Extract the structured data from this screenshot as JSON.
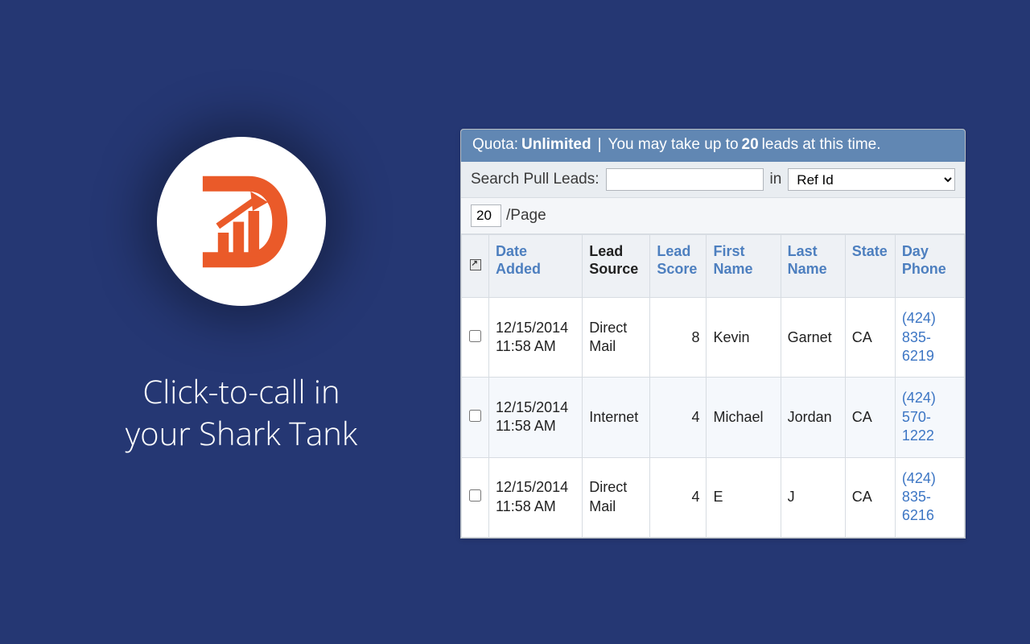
{
  "brand": {
    "accent": "#ea5a29"
  },
  "left": {
    "tagline_l1": "Click-to-call in",
    "tagline_l2": "your Shark Tank"
  },
  "quota": {
    "label": "Quota:",
    "value": "Unlimited",
    "msg_pre": "You may take up to",
    "max": "20",
    "msg_post": "leads at this time."
  },
  "search": {
    "label": "Search Pull Leads:",
    "value": "",
    "in_label": "in",
    "field_options_selected": "Ref Id"
  },
  "paging": {
    "per_page": "20",
    "suffix": "/Page"
  },
  "columns": {
    "date_added": "Date Added",
    "lead_source": "Lead Source",
    "lead_score": "Lead Score",
    "first_name": "First Name",
    "last_name": "Last Name",
    "state": "State",
    "day_phone": "Day Phone"
  },
  "rows": [
    {
      "date": "12/15/2014 11:58 AM",
      "source": "Direct Mail",
      "score": "8",
      "first": "Kevin",
      "last": "Garnet",
      "state": "CA",
      "phone": "(424) 835-6219"
    },
    {
      "date": "12/15/2014 11:58 AM",
      "source": "Internet",
      "score": "4",
      "first": "Michael",
      "last": "Jordan",
      "state": "CA",
      "phone": "(424) 570-1222"
    },
    {
      "date": "12/15/2014 11:58 AM",
      "source": "Direct Mail",
      "score": "4",
      "first": "E",
      "last": "J",
      "state": "CA",
      "phone": "(424) 835-6216"
    }
  ]
}
